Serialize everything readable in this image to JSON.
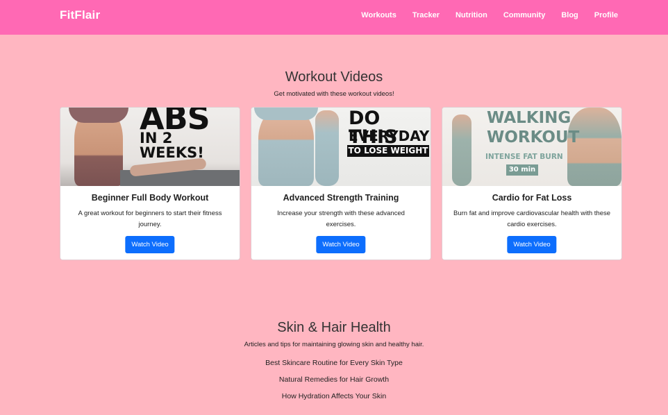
{
  "nav": {
    "brand": "FitFlair",
    "links": [
      "Workouts",
      "Tracker",
      "Nutrition",
      "Community",
      "Blog",
      "Profile"
    ]
  },
  "workouts": {
    "title": "Workout Videos",
    "subtitle": "Get motivated with these workout videos!",
    "cards": [
      {
        "thumb_text": [
          "ABS",
          "IN 2 WEEKS!"
        ],
        "title": "Beginner Full Body Workout",
        "desc": "A great workout for beginners to start their fitness journey.",
        "button": "Watch Video"
      },
      {
        "thumb_text": [
          "DO THIS",
          "EVERYDAY",
          "TO LOSE WEIGHT"
        ],
        "title": "Advanced Strength Training",
        "desc": "Increase your strength with these advanced exercises.",
        "button": "Watch Video"
      },
      {
        "thumb_text": [
          "WALKING",
          "WORKOUT",
          "INTENSE FAT BURN",
          "30 min"
        ],
        "title": "Cardio for Fat Loss",
        "desc": "Burn fat and improve cardiovascular health with these cardio exercises.",
        "button": "Watch Video"
      }
    ]
  },
  "skin_hair": {
    "title": "Skin & Hair Health",
    "subtitle": "Articles and tips for maintaining glowing skin and healthy hair.",
    "articles": [
      "Best Skincare Routine for Every Skin Type",
      "Natural Remedies for Hair Growth",
      "How Hydration Affects Your Skin"
    ]
  },
  "colors": {
    "navbar": "#ff69b4",
    "page_bg": "#ffb6c1",
    "button": "#0d6efd"
  }
}
